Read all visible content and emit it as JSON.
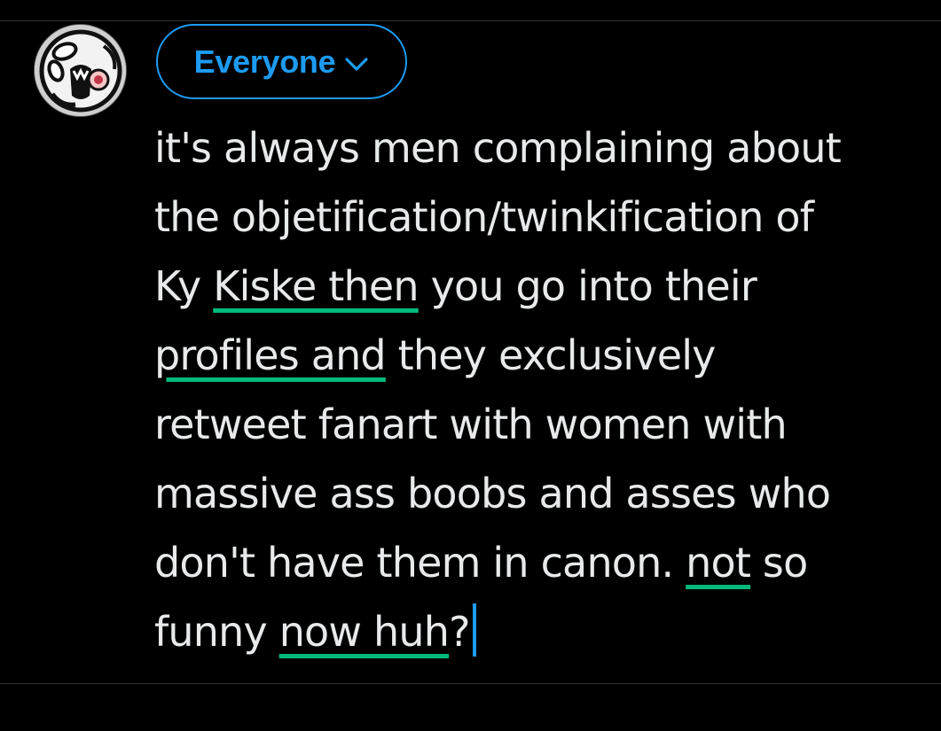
{
  "audience": {
    "label": "Everyone",
    "icon": "chevron-down-icon",
    "accent_color": "#1d9bf0"
  },
  "avatar": {
    "icon": "avatar-image"
  },
  "composer": {
    "spellcheck_underline_color": "#00ba7c",
    "caret_color": "#1d9bf0",
    "lines": [
      {
        "segments": [
          {
            "text": "it's always men complaining about"
          }
        ]
      },
      {
        "segments": [
          {
            "text": "the objetification/twinkification of"
          }
        ]
      },
      {
        "segments": [
          {
            "text": "Ky "
          },
          {
            "text": "Kiske then",
            "flagged": true
          },
          {
            "text": " you go into their"
          }
        ]
      },
      {
        "segments": [
          {
            "text": "profiles and",
            "flagged": true
          },
          {
            "text": " they exclusively"
          }
        ]
      },
      {
        "segments": [
          {
            "text": "retweet fanart with women with"
          }
        ]
      },
      {
        "segments": [
          {
            "text": "massive ass boobs and asses who"
          }
        ]
      },
      {
        "segments": [
          {
            "text": "don't have them in canon. "
          },
          {
            "text": "not",
            "flagged": true
          },
          {
            "text": " so"
          }
        ]
      },
      {
        "segments": [
          {
            "text": "funny "
          },
          {
            "text": "now huh",
            "flagged": true
          },
          {
            "text": "?"
          }
        ]
      }
    ]
  }
}
